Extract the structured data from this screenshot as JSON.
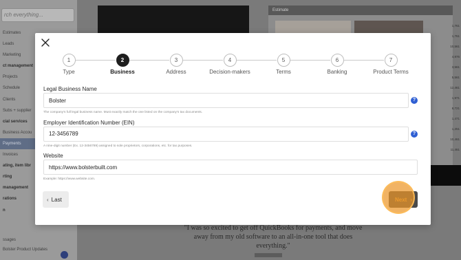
{
  "background": {
    "search_placeholder": "rch everything...",
    "nav_items": [
      {
        "label": "Estimates",
        "active": false,
        "group": false
      },
      {
        "label": "Leads",
        "active": false,
        "group": false
      },
      {
        "label": "Marketing",
        "active": false,
        "group": false
      },
      {
        "label": "ct management",
        "active": false,
        "group": true
      },
      {
        "label": "Projects",
        "active": false,
        "group": false
      },
      {
        "label": "Schedule",
        "active": false,
        "group": false
      },
      {
        "label": "Clients",
        "active": false,
        "group": false
      },
      {
        "label": "Subs + supplier",
        "active": false,
        "group": false
      },
      {
        "label": "cial services",
        "active": false,
        "group": true
      },
      {
        "label": "Business Accou",
        "active": false,
        "group": false
      },
      {
        "label": "Payments",
        "active": true,
        "group": false
      },
      {
        "label": "Invoices",
        "active": false,
        "group": false
      },
      {
        "label": "ating, item libr",
        "active": false,
        "group": true
      },
      {
        "label": "rting",
        "active": false,
        "group": true
      },
      {
        "label": "management",
        "active": false,
        "group": true
      },
      {
        "label": "rations",
        "active": false,
        "group": true
      },
      {
        "label": "n",
        "active": false,
        "group": true
      }
    ],
    "footer_items": [
      "ssages",
      "Bolster Product Updates"
    ],
    "preview_title": "Estimate",
    "right_column_values": [
      "1,761",
      "1,761",
      "10,561",
      "4,976",
      "3,561",
      "5,561",
      "12,461",
      "1,971",
      "8,721",
      "1,471",
      "1,251",
      "10,461",
      "11,461"
    ],
    "quote": "\"I was so excited to get off QuickBooks for payments, and move away from my old software to an all-in-one tool that does everything.\""
  },
  "modal": {
    "close_icon": "close-icon",
    "steps": [
      {
        "number": "1",
        "label": "Type",
        "active": false
      },
      {
        "number": "2",
        "label": "Business",
        "active": true
      },
      {
        "number": "3",
        "label": "Address",
        "active": false
      },
      {
        "number": "4",
        "label": "Decision-makers",
        "active": false
      },
      {
        "number": "5",
        "label": "Terms",
        "active": false
      },
      {
        "number": "6",
        "label": "Banking",
        "active": false
      },
      {
        "number": "7",
        "label": "Product Terms",
        "active": false
      }
    ],
    "fields": {
      "business_name": {
        "label": "Legal Business Name",
        "value": "Bolster",
        "helper": "The company's full legal business name. Must exactly match the one listed on the company's tax documents.",
        "help_icon": "?"
      },
      "ein": {
        "label": "Employer Identification Number (EIN)",
        "value": "12-3456789",
        "helper": "A nine-digit number (Ex. 12-3456789) assigned to sole proprietors, corporations, etc. for tax purposes.",
        "help_icon": "?"
      },
      "website": {
        "label": "Website",
        "value": "https://www.bolsterbuilt.com",
        "helper": "Example: https://www.website.com."
      }
    },
    "buttons": {
      "last_label": "Last",
      "last_icon": "‹",
      "next_label": "Next",
      "next_icon": "›"
    },
    "colors": {
      "accent": "#e7a23a",
      "help_icon": "#2f5fd3",
      "active_step": "#1e1e1e"
    }
  }
}
